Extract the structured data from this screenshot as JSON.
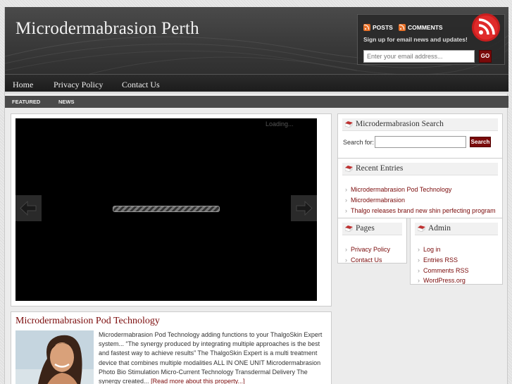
{
  "header": {
    "site_title": "Microdermabrasion Perth",
    "posts_label": "POSTS",
    "comments_label": "COMMENTS",
    "signup_text": "Sign up for email news and updates!",
    "email_placeholder": "Enter your email address...",
    "go_label": "GO"
  },
  "nav": {
    "items": [
      "Home",
      "Privacy Policy",
      "Contact Us"
    ]
  },
  "subnav": {
    "items": [
      "FEATURED",
      "NEWS"
    ]
  },
  "slider": {
    "loading_text": "Loading..."
  },
  "post": {
    "title": "Microdermabrasion Pod Technology",
    "excerpt": "Microdermabrasion Pod Technology adding functions to your ThalgoSkin Expert system... “The synergy produced by integrating multiple approaches is the best and fastest way to achieve results” The ThalgoSkin Expert is a multi treatment device that combines multiple modalities ALL IN ONE UNIT Microdermabrasion Photo Bio Stimulation Micro-Current Technology Transdermal Delivery The synergy created...",
    "more_link": "[Read more about this property...]"
  },
  "sidebar": {
    "search": {
      "title": "Microdermabrasion Search",
      "label": "Search for:",
      "button": "Search"
    },
    "recent": {
      "title": "Recent Entries",
      "items": [
        "Microdermabrasion Pod Technology",
        "Microdermabrasion",
        "Thalgo releases brand new shin perfecting program"
      ]
    },
    "pages": {
      "title": "Pages",
      "items": [
        "Privacy Policy",
        "Contact Us"
      ]
    },
    "admin": {
      "title": "Admin",
      "items": [
        "Log in",
        "Entries RSS",
        "Comments RSS",
        "WordPress.org"
      ]
    }
  },
  "colors": {
    "accent": "#7a0a0a",
    "header_bg": "#3a3a3a",
    "rss": "#e8722a"
  }
}
